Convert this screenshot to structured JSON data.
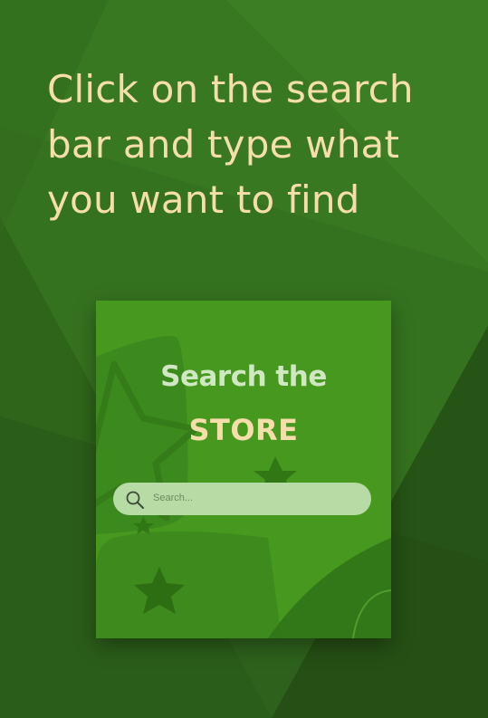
{
  "headline": {
    "line1": "Click on the search",
    "line2": "bar and type what",
    "line3": "you want to find"
  },
  "panel": {
    "title_line1": "Search the",
    "title_line2": "STORE",
    "search": {
      "placeholder": "Search..."
    },
    "icons": {
      "search": "magnifier-icon",
      "decoration": "star-icon"
    }
  },
  "colors": {
    "background": "#35721f",
    "panel": "#46981f",
    "headline_text": "#f6deaa",
    "title_text": "#cfe8c2",
    "search_bar": "#b7dba4"
  }
}
